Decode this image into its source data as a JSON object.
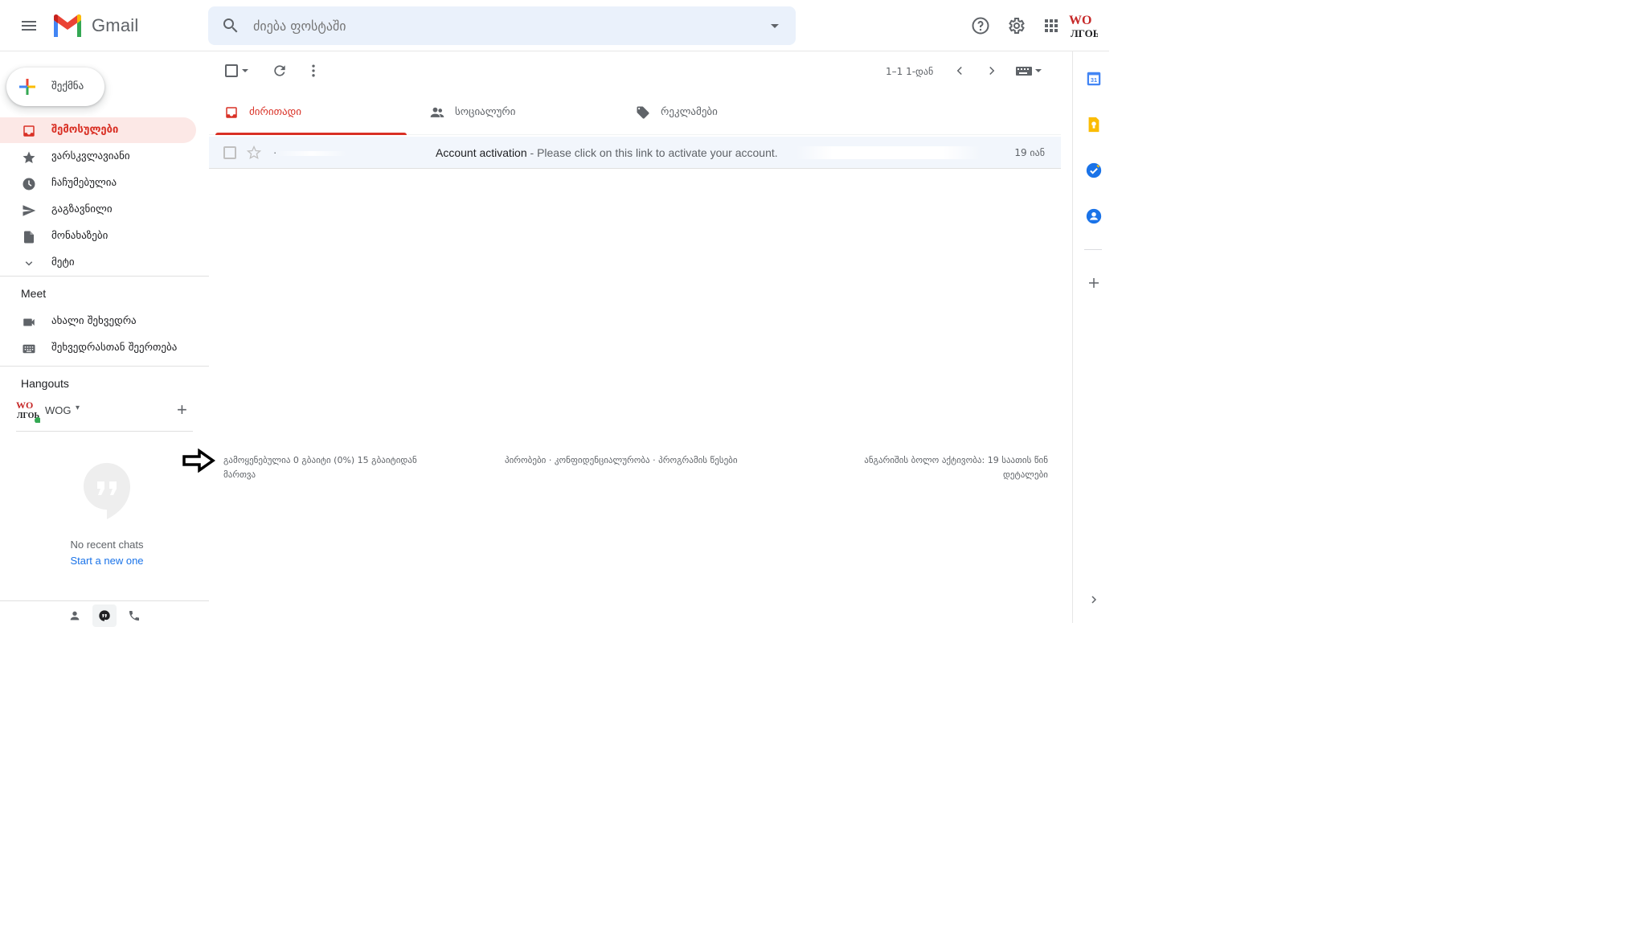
{
  "header": {
    "app_name": "Gmail",
    "search_placeholder": "ძიება ფოსტაში",
    "avatar_label": "WOG"
  },
  "sidebar": {
    "compose_label": "შექმნა",
    "items": [
      {
        "label": "შემოსულები",
        "icon": "inbox-icon",
        "active": true
      },
      {
        "label": "ვარსკვლავიანი",
        "icon": "star-icon"
      },
      {
        "label": "ჩაჩუმებულია",
        "icon": "clock-icon"
      },
      {
        "label": "გაგზავნილი",
        "icon": "send-icon"
      },
      {
        "label": "მონახაზები",
        "icon": "draft-icon"
      },
      {
        "label": "მეტი",
        "icon": "chevron-down-icon"
      }
    ],
    "meet": {
      "title": "Meet",
      "items": [
        {
          "label": "ახალი შეხვედრა",
          "icon": "video-icon"
        },
        {
          "label": "შეხვედრასთან შეერთება",
          "icon": "keyboard-icon"
        }
      ]
    },
    "hangouts": {
      "title": "Hangouts",
      "user": "WOG",
      "no_chats": "No recent chats",
      "start_new": "Start a new one"
    }
  },
  "toolbar": {
    "pager": "1–1 1-დან"
  },
  "tabs": [
    {
      "label": "ძირითადი",
      "icon": "inbox-icon",
      "active": true
    },
    {
      "label": "სოციალური",
      "icon": "people-icon"
    },
    {
      "label": "რეკლამები",
      "icon": "tag-icon"
    }
  ],
  "emails": [
    {
      "sender": "·",
      "subject": "Account activation",
      "snippet": " - Please click on this link to activate your account.",
      "date": "19 იან"
    }
  ],
  "footer": {
    "storage": "გამოყენებულია 0 გბაიტი (0%) 15 გბაიტიდან",
    "manage": "მართვა",
    "links": "პირობები · კონფიდენციალურობა · პროგრამის წესები",
    "activity": "ანგარიშის ბოლო აქტივობა: 19 საათის წინ",
    "details": "დეტალები"
  },
  "colors": {
    "accent": "#d93025",
    "active_bg": "#fce8e6",
    "link": "#1a73e8",
    "search_bg": "#eaf1fb"
  }
}
